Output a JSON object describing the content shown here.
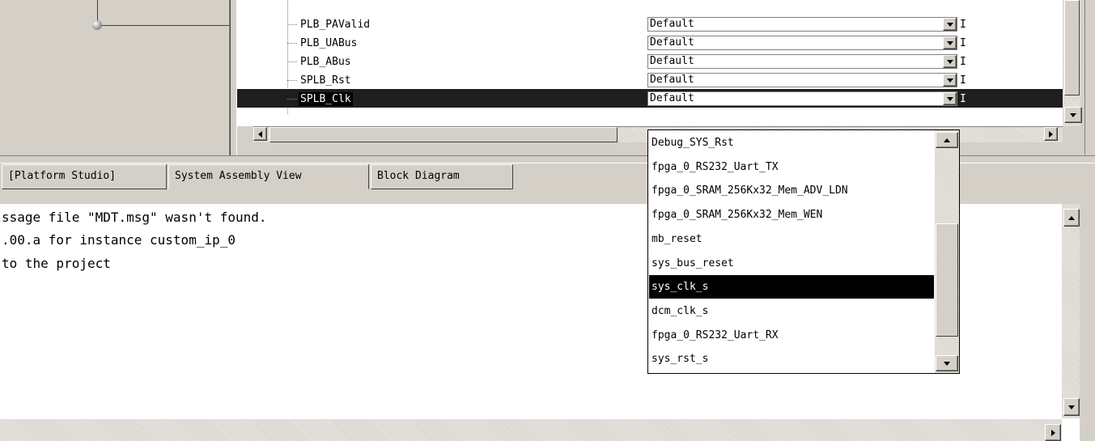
{
  "signals": [
    {
      "name": "PLB_PAValid",
      "value": "Default",
      "col3": "I"
    },
    {
      "name": "PLB_UABus",
      "value": "Default",
      "col3": "I"
    },
    {
      "name": "PLB_ABus",
      "value": "Default",
      "col3": "I"
    },
    {
      "name": "SPLB_Rst",
      "value": "Default",
      "col3": "I"
    },
    {
      "name": "SPLB_Clk",
      "value": "Default",
      "col3": "I",
      "selected": true
    }
  ],
  "dropdown_options": [
    "Debug_SYS_Rst",
    "fpga_0_RS232_Uart_TX",
    "fpga_0_SRAM_256Kx32_Mem_ADV_LDN",
    "fpga_0_SRAM_256Kx32_Mem_WEN",
    "mb_reset",
    "sys_bus_reset",
    "sys_clk_s",
    "dcm_clk_s",
    "fpga_0_RS232_Uart_RX",
    "sys_rst_s"
  ],
  "dropdown_selected": "sys_clk_s",
  "tabs": {
    "platform_studio": "[Platform Studio]",
    "system_assembly": "System Assembly View",
    "block_diagram": "Block Diagram"
  },
  "console_lines": [
    "ssage file \"MDT.msg\" wasn't found.",
    ".00.a for instance custom_ip_0",
    "to the project"
  ],
  "colors": {
    "window_bg": "#d4d0c8",
    "selection_bg": "#000000",
    "selection_fg": "#ffffff"
  },
  "icons": [
    "dropdown-arrow-icon",
    "scroll-up-icon",
    "scroll-down-icon",
    "scroll-left-icon",
    "scroll-right-icon"
  ]
}
